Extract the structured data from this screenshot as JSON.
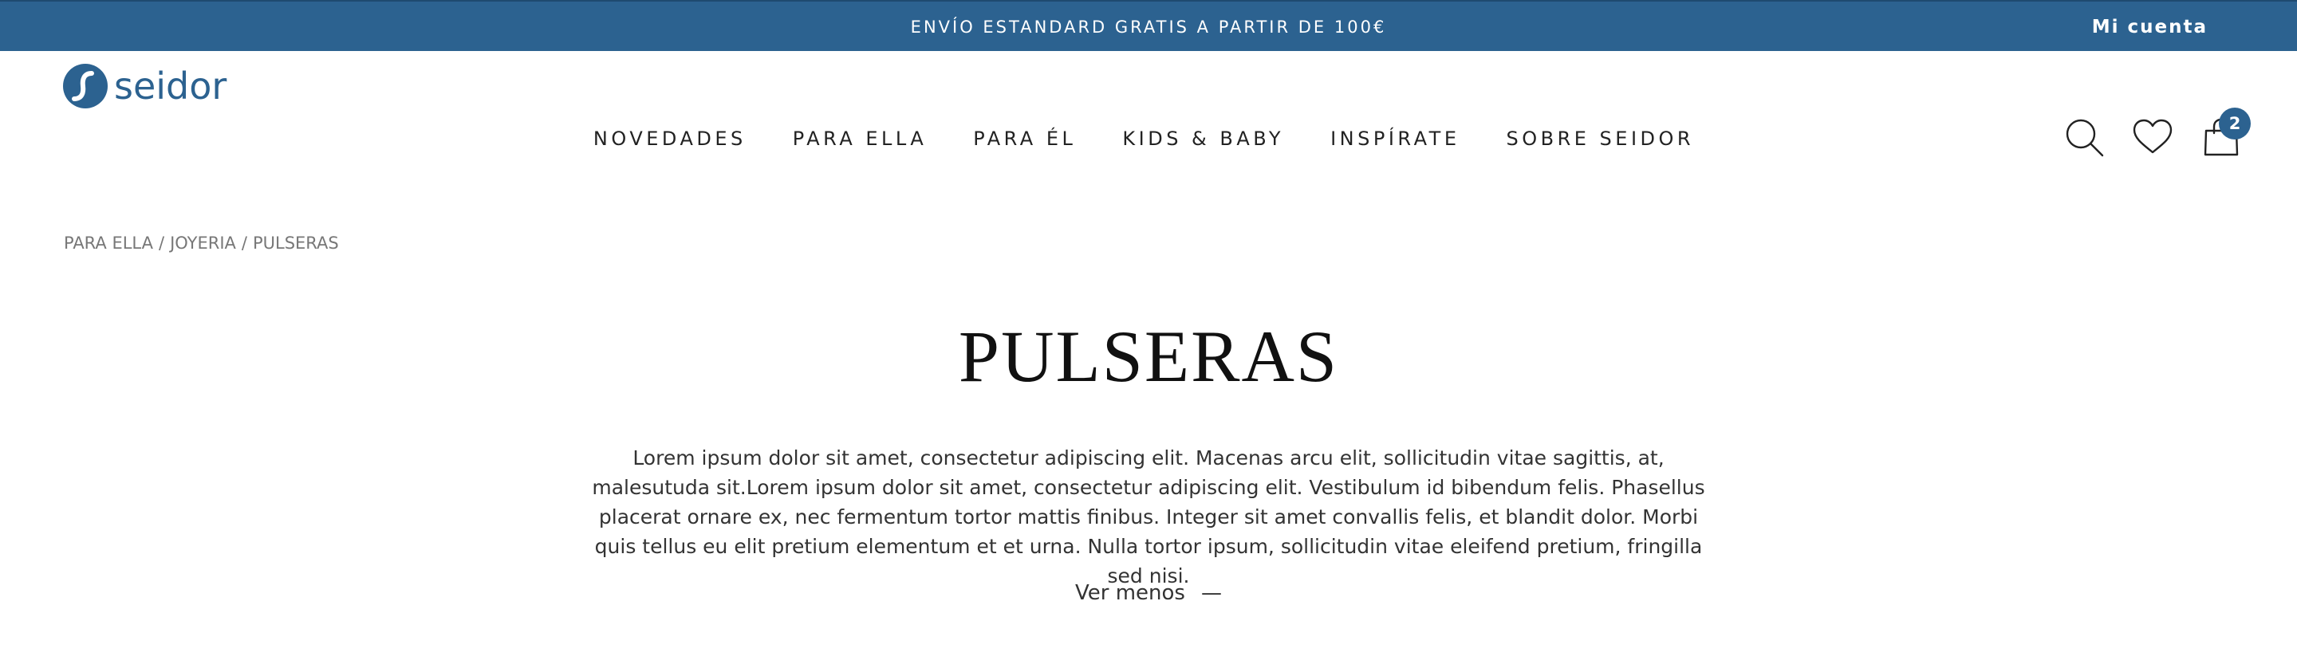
{
  "topbar": {
    "promo": "ENVÍO ESTANDARD GRATIS A PARTIR DE 100€",
    "account_label": "Mi cuenta",
    "background_color": "#2c6290"
  },
  "header": {
    "logo_text": "seidor",
    "brand_color": "#2c6290",
    "nav": [
      "NOVEDADES",
      "PARA ELLA",
      "PARA ÉL",
      "KIDS & BABY",
      "INSPÍRATE",
      "SOBRE SEIDOR"
    ],
    "icons": {
      "search": "search-icon",
      "wishlist": "heart-icon",
      "cart": "shopping-bag-icon"
    },
    "cart_count": "2"
  },
  "breadcrumb": [
    "PARA ELLA",
    "JOYERIA",
    "PULSERAS"
  ],
  "breadcrumb_separator": "/",
  "page": {
    "title": "PULSERAS",
    "description": "Lorem ipsum dolor sit amet, consectetur adipiscing elit. Macenas arcu elit, sollicitudin vitae sagittis, at, malesutuda sit.Lorem ipsum dolor sit amet, consectetur adipiscing elit. Vestibulum id bibendum felis. Phasellus placerat ornare ex, nec fermentum tortor mattis finibus. Integer sit amet convallis felis, et blandit dolor. Morbi quis tellus eu elit pretium elementum et et urna. Nulla tortor ipsum, sollicitudin vitae eleifend pretium, fringilla sed nisi.",
    "toggle_label": "Ver  menos",
    "toggle_symbol": "—"
  }
}
